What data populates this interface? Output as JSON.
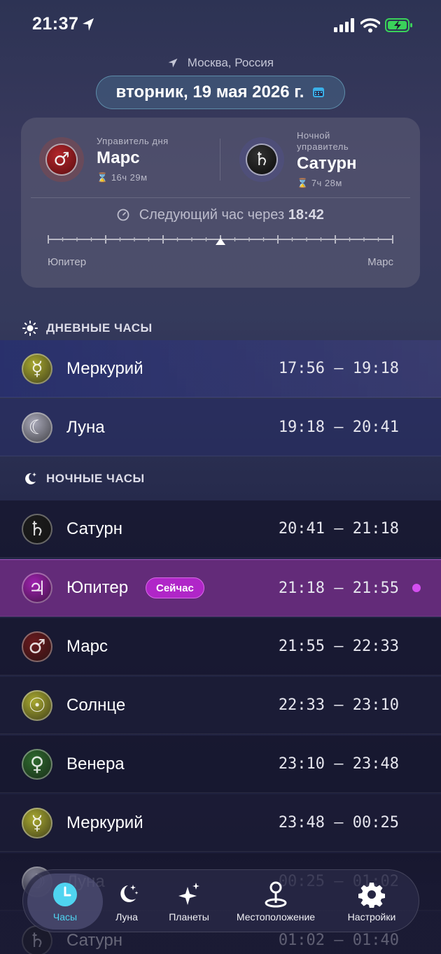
{
  "status_bar": {
    "time": "21:37"
  },
  "header": {
    "location": "Москва, Россия",
    "date": "вторник, 19 мая 2026 г."
  },
  "rulers": {
    "day": {
      "caption": "Управитель дня",
      "name": "Марс",
      "duration": "16ч 29м",
      "symbol": "♂"
    },
    "night": {
      "caption_line1": "Ночной",
      "caption_line2": "управитель",
      "name": "Сатурн",
      "duration": "7ч 28м",
      "symbol": "♄"
    },
    "next_hour_label": "Следующий час через",
    "next_hour_value": "18:42",
    "scale_left": "Юпитер",
    "scale_right": "Марс",
    "scale_position": 0.5
  },
  "sections": {
    "day_title": "ДНЕВНЫЕ ЧАСЫ",
    "night_title": "НОЧНЫЕ ЧАСЫ"
  },
  "day_hours": [
    {
      "symbol": "☿",
      "name": "Меркурий",
      "time": "17:56 – 19:18",
      "color": "#a8a830"
    },
    {
      "symbol": "☾",
      "name": "Луна",
      "time": "19:18 – 20:41",
      "color": "#a8a8b8"
    }
  ],
  "night_hours": [
    {
      "symbol": "♄",
      "name": "Сатурн",
      "time": "20:41 – 21:18",
      "color": "#1c1c1c"
    },
    {
      "symbol": "♃",
      "name": "Юпитер",
      "time": "21:18 – 21:55",
      "color": "#a020b0",
      "badge": "Сейчас"
    },
    {
      "symbol": "♂",
      "name": "Марс",
      "time": "21:55 – 22:33",
      "color": "#6a1a1e"
    },
    {
      "symbol": "☉",
      "name": "Солнце",
      "time": "22:33 – 23:10",
      "color": "#a8a830"
    },
    {
      "symbol": "♀",
      "name": "Венера",
      "time": "23:10 – 23:48",
      "color": "#2e6a2e"
    },
    {
      "symbol": "☿",
      "name": "Меркурий",
      "time": "23:48 – 00:25",
      "color": "#a8a830"
    },
    {
      "symbol": "☽",
      "name": "Луна",
      "time": "00:25 – 01:02",
      "color": "#a8a8b8"
    },
    {
      "symbol": "♄",
      "name": "Сатурн",
      "time": "01:02 – 01:40",
      "color": "#1c1c1c"
    }
  ],
  "tabs": [
    {
      "label": "Часы",
      "icon": "clock-icon",
      "active": true
    },
    {
      "label": "Луна",
      "icon": "moon-stars-icon"
    },
    {
      "label": "Планеты",
      "icon": "sparkles-icon"
    },
    {
      "label": "Местоположение",
      "icon": "map-pin-icon"
    },
    {
      "label": "Настройки",
      "icon": "gear-icon"
    }
  ],
  "colors": {
    "accent": "#4fd4f0",
    "now_highlight": "#b026c8",
    "mars": "#7a1f22",
    "saturn": "#1e1e24"
  }
}
